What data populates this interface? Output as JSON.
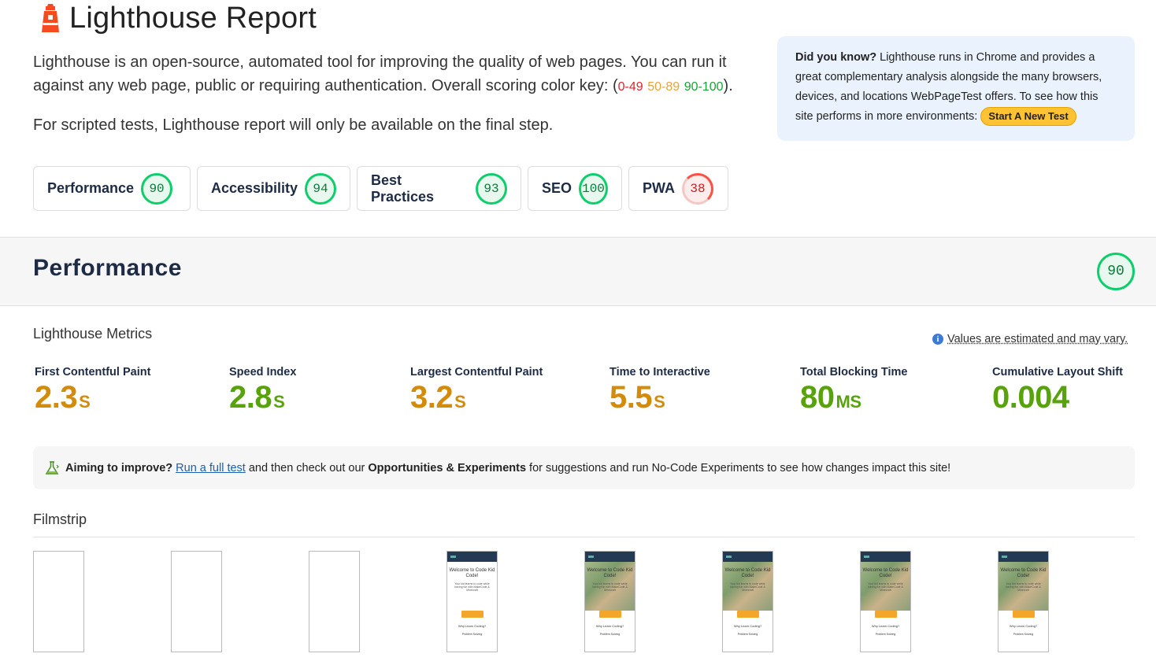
{
  "header": {
    "title": "Lighthouse Report",
    "logo_icon": "lighthouse-icon"
  },
  "intro": {
    "line1": "Lighthouse is an open-source, automated tool for improving the quality of web pages. You can run it against any web page, public or requiring authentication. Overall scoring color key: (",
    "key_red": "0-49",
    "key_orange": "50-89",
    "key_green": "90-100",
    "line1_end": ").",
    "line2": "For scripted tests, Lighthouse report will only be available on the final step."
  },
  "did_you_know": {
    "bold": "Did you know?",
    "text": " Lighthouse runs in Chrome and provides a great complementary analysis alongside the many browsers, devices, and locations WebPageTest offers. To see how this site performs in more environments: ",
    "button": "Start A New Test"
  },
  "categories": [
    {
      "label": "Performance",
      "score": "90"
    },
    {
      "label": "Accessibility",
      "score": "94"
    },
    {
      "label": "Best Practices",
      "score": "93"
    },
    {
      "label": "SEO",
      "score": "100"
    },
    {
      "label": "PWA",
      "score": "38"
    }
  ],
  "performance": {
    "heading": "Performance",
    "score": "90",
    "metrics_heading": "Lighthouse Metrics",
    "estimate_note": "Values are estimated and may vary.",
    "metrics": [
      {
        "label": "First Contentful Paint",
        "value": "2.3",
        "unit": "S",
        "status": "average",
        "color": "#d38b0c"
      },
      {
        "label": "Speed Index",
        "value": "2.8",
        "unit": "S",
        "status": "good",
        "color": "#58a20b"
      },
      {
        "label": "Largest Contentful Paint",
        "value": "3.2",
        "unit": "S",
        "status": "average",
        "color": "#d38b0c"
      },
      {
        "label": "Time to Interactive",
        "value": "5.5",
        "unit": "S",
        "status": "average",
        "color": "#d38b0c"
      },
      {
        "label": "Total Blocking Time",
        "value": "80",
        "unit": "MS",
        "status": "good",
        "color": "#58a20b"
      },
      {
        "label": "Cumulative Layout Shift",
        "value": "0.004",
        "unit": "",
        "status": "good",
        "color": "#58a20b"
      }
    ]
  },
  "aim": {
    "bold": "Aiming to improve?",
    "link": "Run a full test",
    "mid": "and then check out our",
    "bold2": "Opportunities & Experiments",
    "end": "for suggestions and run No-Code Experiments to see how changes impact this site!",
    "icon": "flask-icon"
  },
  "filmstrip": {
    "heading": "Filmstrip",
    "frame_title": "Welcome to Code Kid Code!",
    "frame_subtitle": "Your kid learns to code while having fun with MakeCode & Minecraft",
    "frame_section": "Why Learn Coding?",
    "frame_footer": "Problem Solving",
    "frames": [
      "blank",
      "blank",
      "blank",
      "text",
      "image",
      "image",
      "image",
      "image"
    ]
  },
  "colors": {
    "good": "#0cce6b",
    "average": "#d38b0c",
    "poor": "#ff4e42",
    "accent": "#ffc233"
  }
}
